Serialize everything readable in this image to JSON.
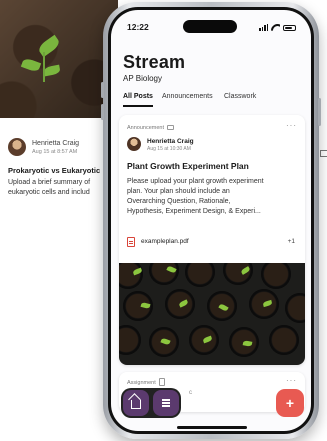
{
  "background_post": {
    "author": "Henrietta Craig",
    "date": "Aug 15 at 8:57 AM",
    "title": "Prokaryotic vs Eukaryotic",
    "body": "Upload a brief summary of\neukaryotic cells and includ"
  },
  "status_bar": {
    "time": "12:22"
  },
  "header": {
    "title": "Stream",
    "subtitle": "AP Biology"
  },
  "tabs": [
    {
      "label": "All Posts",
      "active": true
    },
    {
      "label": "Announcements",
      "active": false
    },
    {
      "label": "Classwork",
      "active": false
    }
  ],
  "post": {
    "kind": "Announcement",
    "author": "Henrietta Craig",
    "date": "Aug 15 at 10:30 AM",
    "title": "Plant Growth Experiment Plan",
    "body": "Please upload your plant growth experiment\nplan. Your plan should include an\nOverarching Question, Rationale,\nHypothesis, Experiment Design, & Experi...",
    "attachment": {
      "file_name": "exampleplan.pdf",
      "extra_count": "+1"
    }
  },
  "next_post": {
    "kind": "Assignment",
    "peek_text": "c"
  },
  "bottom_bar": {
    "add_label": "+"
  },
  "colors": {
    "accent_purple": "#5b3a6e",
    "accent_red": "#e85a52"
  }
}
